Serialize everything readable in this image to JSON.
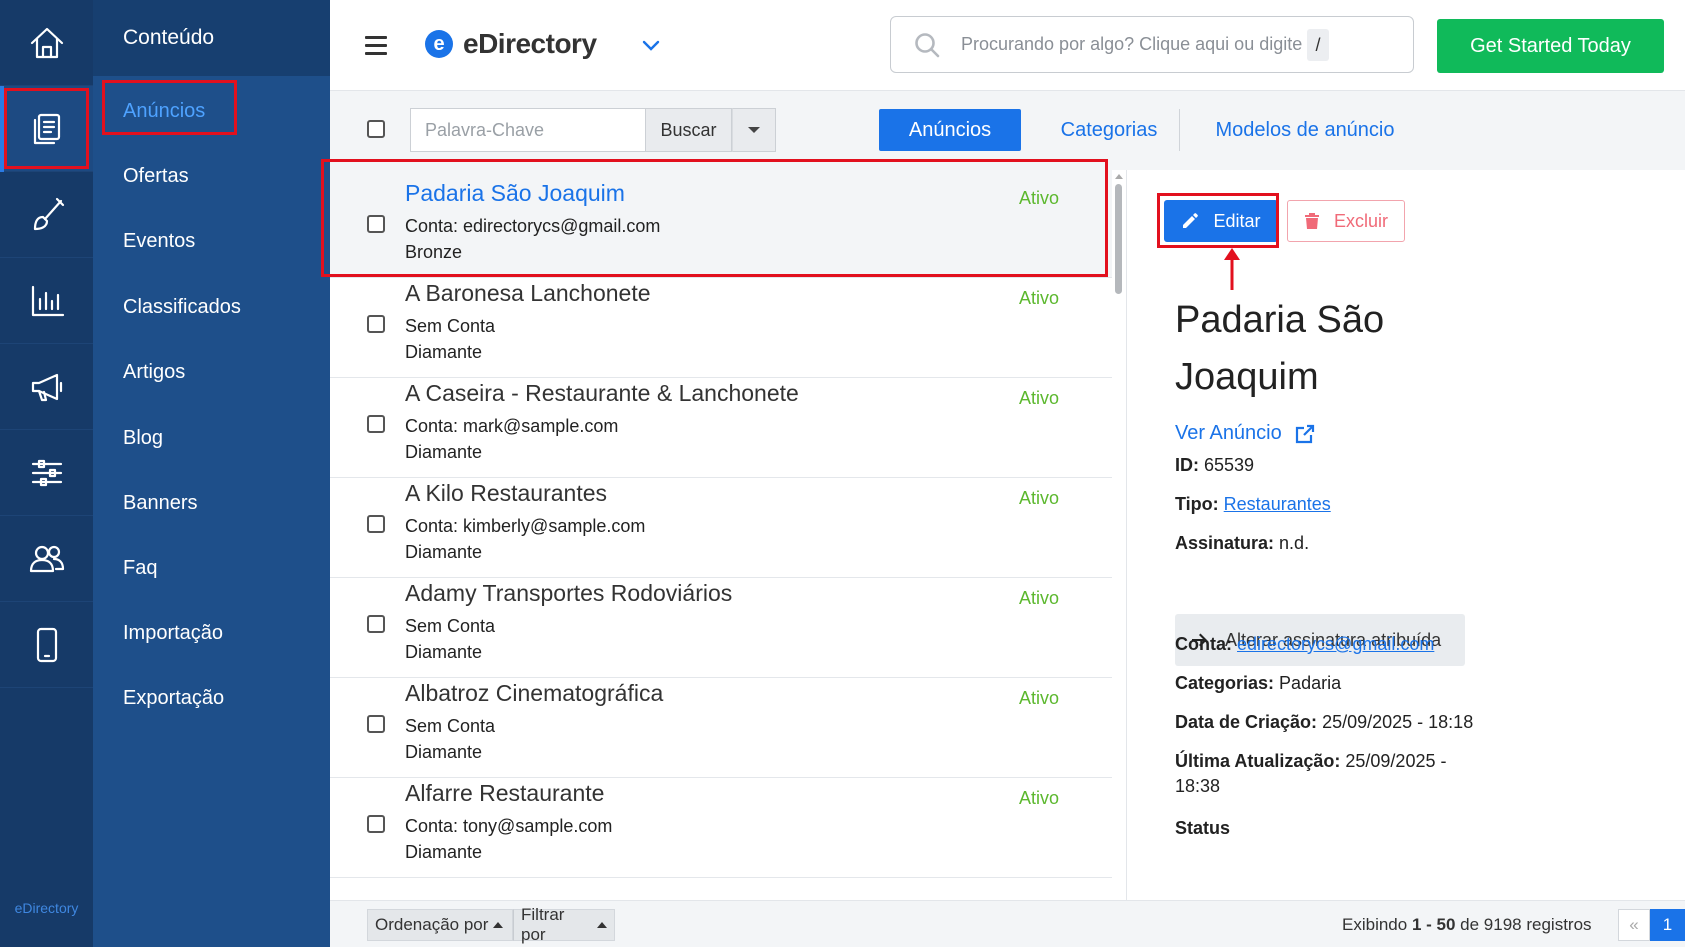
{
  "rail": {
    "brand": "eDirectory",
    "icons": [
      "home-icon",
      "content-icon",
      "brush-icon",
      "chart-icon",
      "megaphone-icon",
      "sliders-icon",
      "users-icon",
      "mobile-icon"
    ]
  },
  "menu": {
    "header": "Conteúdo",
    "items": [
      "Anúncios",
      "Ofertas",
      "Eventos",
      "Classificados",
      "Artigos",
      "Blog",
      "Banners",
      "Faq",
      "Importação",
      "Exportação"
    ]
  },
  "topbar": {
    "brand_letter": "e",
    "brand_name": "eDirectory",
    "search_placeholder": "Procurando por algo? Clique aqui ou digite",
    "search_shortcut": "/",
    "cta": "Get Started Today"
  },
  "toolbar": {
    "keyword_placeholder": "Palavra-Chave",
    "search_button": "Buscar",
    "tabs": [
      "Anúncios",
      "Categorias",
      "Modelos de anúncio"
    ]
  },
  "listings": [
    {
      "title": "Padaria São Joaquim",
      "account": "Conta: edirectorycs@gmail.com",
      "level": "Bronze",
      "status": "Ativo"
    },
    {
      "title": "A Baronesa Lanchonete",
      "account": "Sem Conta",
      "level": "Diamante",
      "status": "Ativo"
    },
    {
      "title": "A Caseira - Restaurante & Lanchonete",
      "account": "Conta: mark@sample.com",
      "level": "Diamante",
      "status": "Ativo"
    },
    {
      "title": "A Kilo Restaurantes",
      "account": "Conta: kimberly@sample.com",
      "level": "Diamante",
      "status": "Ativo"
    },
    {
      "title": "Adamy Transportes Rodoviários",
      "account": "Sem Conta",
      "level": "Diamante",
      "status": "Ativo"
    },
    {
      "title": "Albatroz Cinematográfica",
      "account": "Sem Conta",
      "level": "Diamante",
      "status": "Ativo"
    },
    {
      "title": "Alfarre Restaurante",
      "account": "Conta: tony@sample.com",
      "level": "Diamante",
      "status": "Ativo"
    }
  ],
  "detail": {
    "edit_button": "Editar",
    "delete_button": "Excluir",
    "title": "Padaria São Joaquim",
    "view_link": "Ver Anúncio",
    "id_label": "ID:",
    "id_value": "65539",
    "type_label": "Tipo:",
    "type_value": "Restaurantes",
    "subscription_label": "Assinatura:",
    "subscription_value": "n.d.",
    "change_subscription_button": "Alterar assinatura atribuída",
    "account_label": "Conta:",
    "account_value": "edirectorycs@gmail.com",
    "categories_label": "Categorias:",
    "categories_value": "Padaria",
    "created_label": "Data de Criação:",
    "created_value": "25/09/2025 - 18:18",
    "updated_label": "Última Atualização:",
    "updated_value_line1": "25/09/2025 -",
    "updated_value_line2": "18:38",
    "status_label": "Status"
  },
  "footer": {
    "sort": "Ordenação por",
    "filter": "Filtrar por",
    "records_prefix": "Exibindo",
    "records_range": "1 - 50",
    "records_suffix": "de 9198 registros",
    "prev": "«",
    "page": "1"
  },
  "colors": {
    "rail_bg": "#163a68",
    "menu_bg": "#1e4f8a",
    "accent": "#1a73e8",
    "cta_green": "#10ba5a",
    "status_green": "#5cb82e",
    "danger": "#f06a78",
    "highlight_red": "#e2101e"
  }
}
